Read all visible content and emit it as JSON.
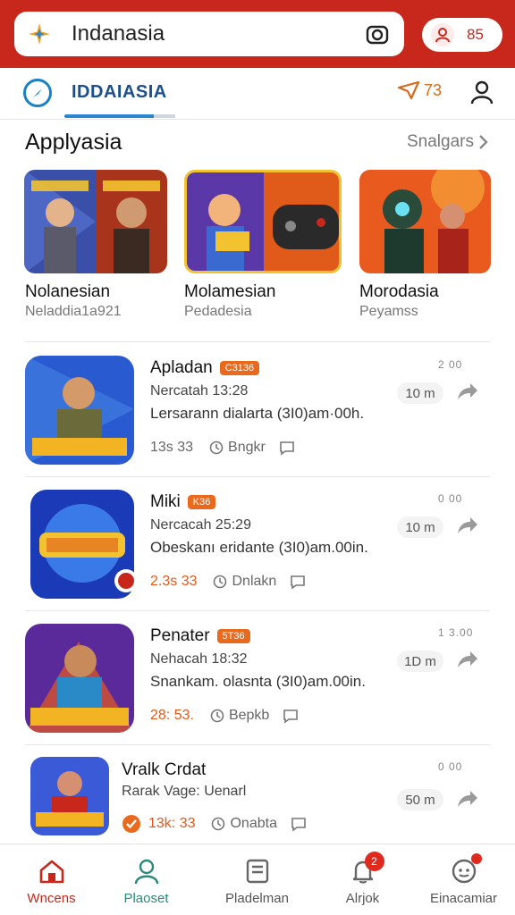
{
  "search": {
    "placeholder": "Indanasia",
    "logo_icon": "sparkle-logo-icon",
    "camera_icon": "camera-icon"
  },
  "account_pill": {
    "count": "85",
    "icon": "user-badge-icon"
  },
  "header": {
    "brand_label": "IDDAIASIA",
    "coins_count": "73",
    "coins_icon": "send-icon",
    "user_icon": "person-icon"
  },
  "section": {
    "title": "Applyasia",
    "more_label": "Snalgars"
  },
  "featured": [
    {
      "name": "Nolanesian",
      "sub": "Neladdia1a921"
    },
    {
      "name": "Molamesian",
      "sub": "Pedadesia"
    },
    {
      "name": "Morodasia",
      "sub": "Peyamss"
    }
  ],
  "apps": [
    {
      "title": "Apladan",
      "badge": "C3136",
      "line1": "Nercatah 13:28",
      "line2": "Lersarann dialarta (3I0)am·00h.",
      "rating": "13s 33",
      "meta1": "Bngkr",
      "meta1_icon": "clock-icon",
      "corner": "2 00",
      "count": "10 m",
      "hot": false
    },
    {
      "title": "Miki",
      "badge": "K36",
      "line1": "Nercacah 25:29",
      "line2": "Obeskanı eridante (3I0)am.00in.",
      "rating": "2.3s 33",
      "meta1": "Dnlakn",
      "meta1_icon": "clock-icon",
      "corner": "0 00",
      "count": "10 m",
      "hot": true
    },
    {
      "title": "Penater",
      "badge": "5T36",
      "line1": "Nehacah 18:32",
      "line2": "Snankam. olasnta (3I0)am.00in.",
      "rating": "28: 53.",
      "meta1": "Bepkb",
      "meta1_icon": "clock-icon",
      "corner": "1 3.00",
      "count": "1D m",
      "hot": true
    },
    {
      "title": "Vralk Crdat",
      "badge": "",
      "line1": "Rarak Vage: Uenarl",
      "line2": "",
      "rating": "13k: 33",
      "meta1": "Onabta",
      "meta1_icon": "clock-icon",
      "corner": "0 00",
      "count": "50 m",
      "hot": false
    }
  ],
  "bottom_nav": [
    {
      "label": "Wncens",
      "icon": "home-icon"
    },
    {
      "label": "Plaoset",
      "icon": "profile-icon"
    },
    {
      "label": "Pladelman",
      "icon": "file-icon"
    },
    {
      "label": "Alrjok",
      "icon": "bell-icon",
      "badge": "2"
    },
    {
      "label": "Einacamiar",
      "icon": "chat-icon"
    }
  ],
  "colors": {
    "brand_red": "#c8281c",
    "accent_blue": "#2a86d0",
    "badge_orange": "#ea6a1d"
  }
}
